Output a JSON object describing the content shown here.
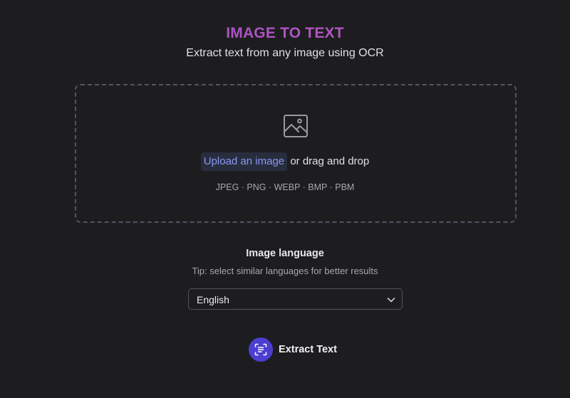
{
  "header": {
    "title": "IMAGE TO TEXT",
    "subtitle": "Extract text from any image using OCR"
  },
  "upload": {
    "icon": "image-icon",
    "link_label": "Upload an image",
    "suffix": "or drag and drop",
    "formats": "JPEG · PNG · WEBP · BMP · PBM"
  },
  "language": {
    "label": "Image language",
    "tip": "Tip: select similar languages for better results",
    "selected": "English"
  },
  "action": {
    "label": "Extract Text",
    "icon": "scan-text-icon"
  },
  "colors": {
    "background": "#1d1d1f",
    "title_gradient_start": "#9b4fd0",
    "title_gradient_end": "#c45ab8",
    "link": "#8a98f2",
    "accent": "#4b3fd0"
  }
}
